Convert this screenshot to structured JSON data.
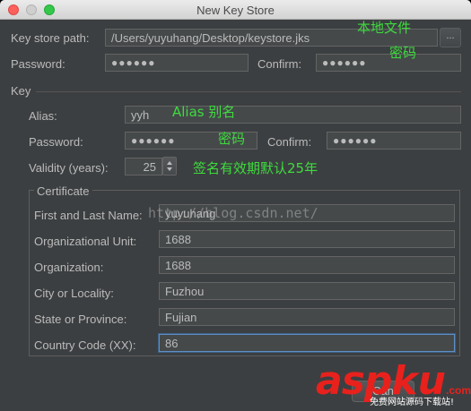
{
  "window": {
    "title": "New Key Store"
  },
  "keystore": {
    "path_label": "Key store path:",
    "path_value": "/Users/yuyuhang/Desktop/keystore.jks",
    "browse_label": "...",
    "password_label": "Password:",
    "password_value": "●●●●●●",
    "confirm_label": "Confirm:",
    "confirm_value": "●●●●●●"
  },
  "key": {
    "section_label": "Key",
    "alias_label": "Alias:",
    "alias_value": "yyh",
    "password_label": "Password:",
    "password_value": "●●●●●●",
    "confirm_label": "Confirm:",
    "confirm_value": "●●●●●●",
    "validity_label": "Validity (years):",
    "validity_value": "25"
  },
  "certificate": {
    "title": "Certificate",
    "fields": [
      {
        "label": "First and Last Name:",
        "value": "yuyuhang"
      },
      {
        "label": "Organizational Unit:",
        "value": "1688"
      },
      {
        "label": "Organization:",
        "value": "1688"
      },
      {
        "label": "City or Locality:",
        "value": "Fuzhou"
      },
      {
        "label": "State or Province:",
        "value": "Fujian"
      },
      {
        "label": "Country Code (XX):",
        "value": "86"
      }
    ]
  },
  "annotations": {
    "local_file": "本地文件",
    "password": "密码",
    "alias": "Alias 别名",
    "password2": "密码",
    "validity": "签名有效期默认25年"
  },
  "watermark": {
    "url": "http://blog.csdn.net/",
    "logo_a": "asp",
    "logo_b": "ku",
    "logo_c": ".com",
    "tagline": "免费网站源码下载站!"
  },
  "buttons": {
    "cancel_label": "Can"
  },
  "colors": {
    "annotation": "#3ddc3d",
    "logo": "#e8211d",
    "focus_border": "#5f8ec4"
  }
}
